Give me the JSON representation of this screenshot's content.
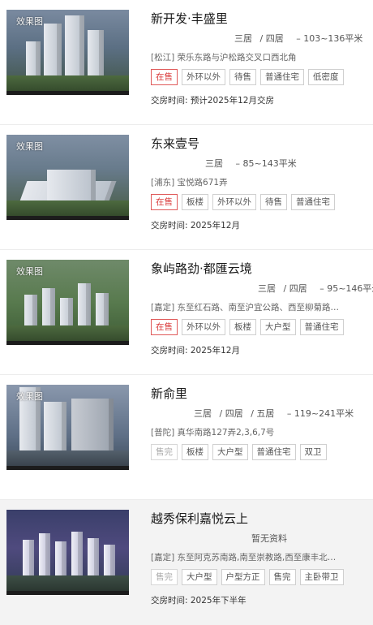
{
  "listings": [
    {
      "image_caption": "效果图",
      "name": "新开发·丰盛里",
      "layouts": [
        "三居",
        "/ 四居"
      ],
      "area": "– 103~136平米",
      "address": "[松江] 荣乐东路与沪松路交叉口西北角",
      "tags": [
        "在售",
        "外环以外",
        "待售",
        "普通住宅",
        "低密度"
      ],
      "delivery": "交房时间:  预计2025年12月交房"
    },
    {
      "image_caption": "效果图",
      "name": "东来壹号",
      "layouts": [
        "三居"
      ],
      "area": "– 85~143平米",
      "address": "[浦东] 宝悦路671弄",
      "tags": [
        "在售",
        "板楼",
        "外环以外",
        "待售",
        "普通住宅"
      ],
      "delivery": "交房时间:  2025年12月"
    },
    {
      "image_caption": "效果图",
      "name": "象屿路劲·都匯云境",
      "layouts": [
        "三居",
        "/ 四居"
      ],
      "area": "– 95~146平米",
      "address": "[嘉定] 东至红石路、南至沪宜公路、西至柳菊路…",
      "tags": [
        "在售",
        "外环以外",
        "板楼",
        "大户型",
        "普通住宅"
      ],
      "delivery": "交房时间:  2025年12月"
    },
    {
      "image_caption": "效果图",
      "name": "新俞里",
      "layouts": [
        "三居",
        "/ 四居",
        "/ 五居"
      ],
      "area": "– 119~241平米",
      "address": "[普陀] 真华南路127弄2,3,6,7号",
      "tags": [
        "售完",
        "板楼",
        "大户型",
        "普通住宅",
        "双卫"
      ],
      "delivery": ""
    },
    {
      "image_caption": "",
      "name": "越秀保利嘉悦云上",
      "layouts": [],
      "area": "暂无资料",
      "address": "[嘉定] 东至阿克苏南路,南至崇教路,西至康丰北…",
      "tags": [
        "售完",
        "大户型",
        "户型方正",
        "售完",
        "主卧带卫"
      ],
      "delivery": "交房时间:  2025年下半年"
    }
  ],
  "colors": {
    "on_sale_tag": "#d93a3a",
    "sold_out_tag": "#aaaaaa"
  }
}
